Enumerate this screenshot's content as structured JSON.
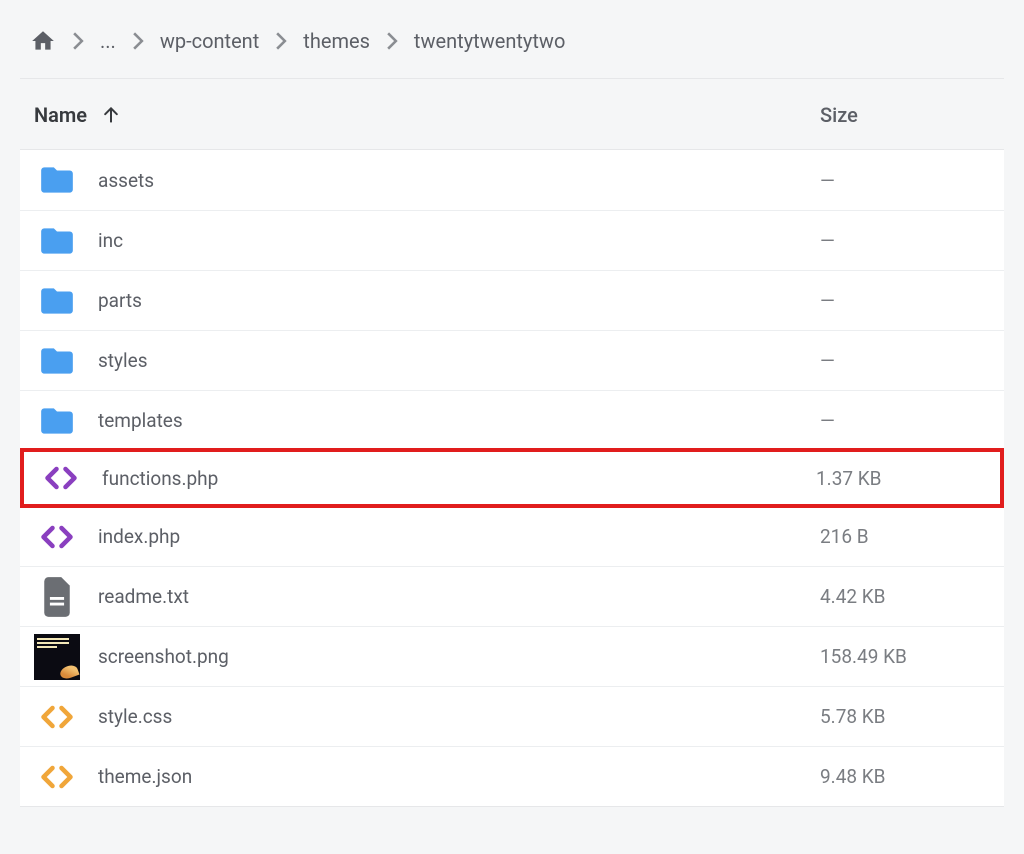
{
  "breadcrumb": {
    "ellipsis": "...",
    "items": [
      "wp-content",
      "themes",
      "twentytwentytwo"
    ]
  },
  "columns": {
    "name": "Name",
    "size": "Size"
  },
  "sort": {
    "column": "name",
    "direction": "asc"
  },
  "files": [
    {
      "name": "assets",
      "size": "—",
      "icon": "folder"
    },
    {
      "name": "inc",
      "size": "—",
      "icon": "folder"
    },
    {
      "name": "parts",
      "size": "—",
      "icon": "folder"
    },
    {
      "name": "styles",
      "size": "—",
      "icon": "folder"
    },
    {
      "name": "templates",
      "size": "—",
      "icon": "folder"
    },
    {
      "name": "functions.php",
      "size": "1.37 KB",
      "icon": "code-purple",
      "highlighted": true
    },
    {
      "name": "index.php",
      "size": "216 B",
      "icon": "code-purple"
    },
    {
      "name": "readme.txt",
      "size": "4.42 KB",
      "icon": "text"
    },
    {
      "name": "screenshot.png",
      "size": "158.49 KB",
      "icon": "image"
    },
    {
      "name": "style.css",
      "size": "5.78 KB",
      "icon": "code-orange"
    },
    {
      "name": "theme.json",
      "size": "9.48 KB",
      "icon": "code-orange"
    }
  ],
  "colors": {
    "folder": "#4a9ff0",
    "code_purple": "#8a3fbf",
    "code_orange": "#f0a63a",
    "doc": "#6b6e73"
  }
}
